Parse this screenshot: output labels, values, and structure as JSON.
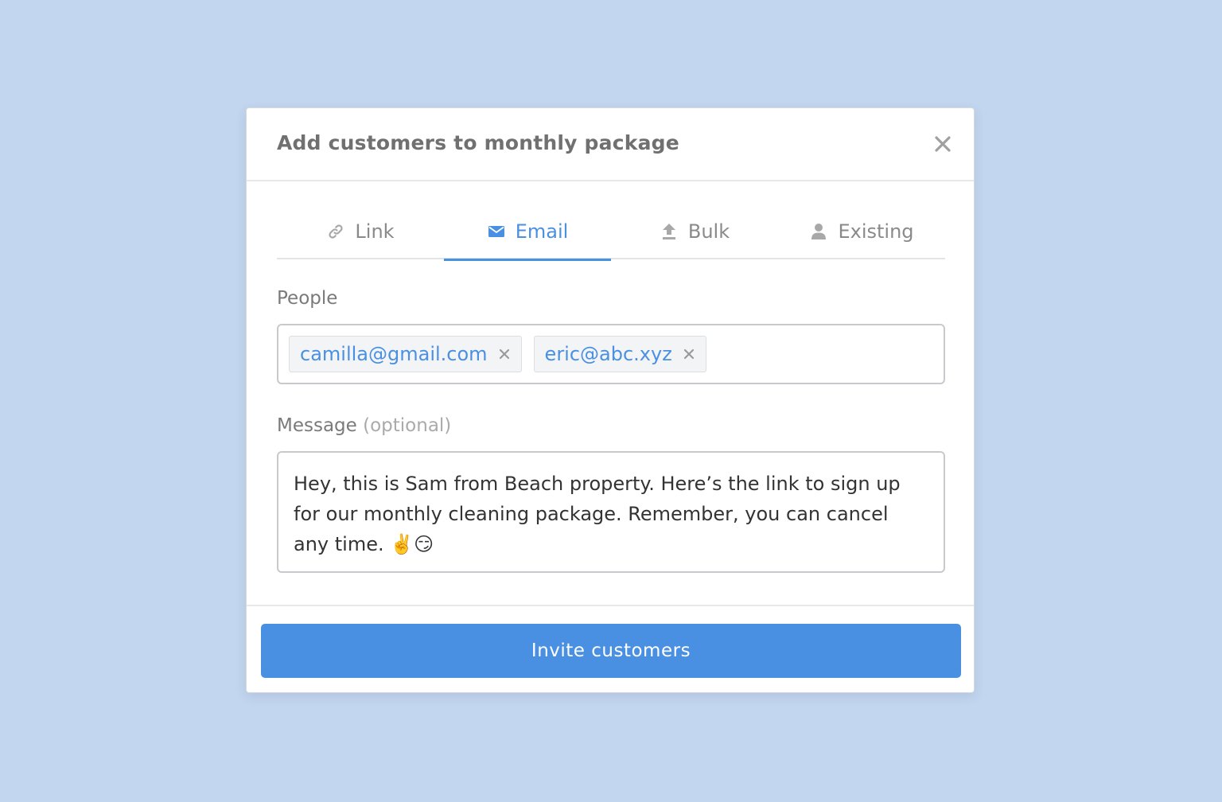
{
  "colors": {
    "background": "#c3d6ef",
    "accent": "#4a90e2",
    "tab_inactive": "#8a8a8a",
    "title": "#707070"
  },
  "modal": {
    "title": "Add customers to monthly package",
    "close_icon": "close-icon"
  },
  "tabs": [
    {
      "label": "Link",
      "icon": "link-icon",
      "active": false
    },
    {
      "label": "Email",
      "icon": "envelope-icon",
      "active": true
    },
    {
      "label": "Bulk",
      "icon": "upload-icon",
      "active": false
    },
    {
      "label": "Existing",
      "icon": "person-icon",
      "active": false
    }
  ],
  "people": {
    "label": "People",
    "chips": [
      {
        "email": "camilla@gmail.com"
      },
      {
        "email": "eric@abc.xyz"
      }
    ]
  },
  "message": {
    "label": "Message",
    "optional": "(optional)",
    "value": "Hey, this is Sam from Beach property. Here’s the link to sign up for our monthly cleaning package. Remember, you can cancel any time. ✌️😏"
  },
  "footer": {
    "invite_label": "Invite customers"
  }
}
